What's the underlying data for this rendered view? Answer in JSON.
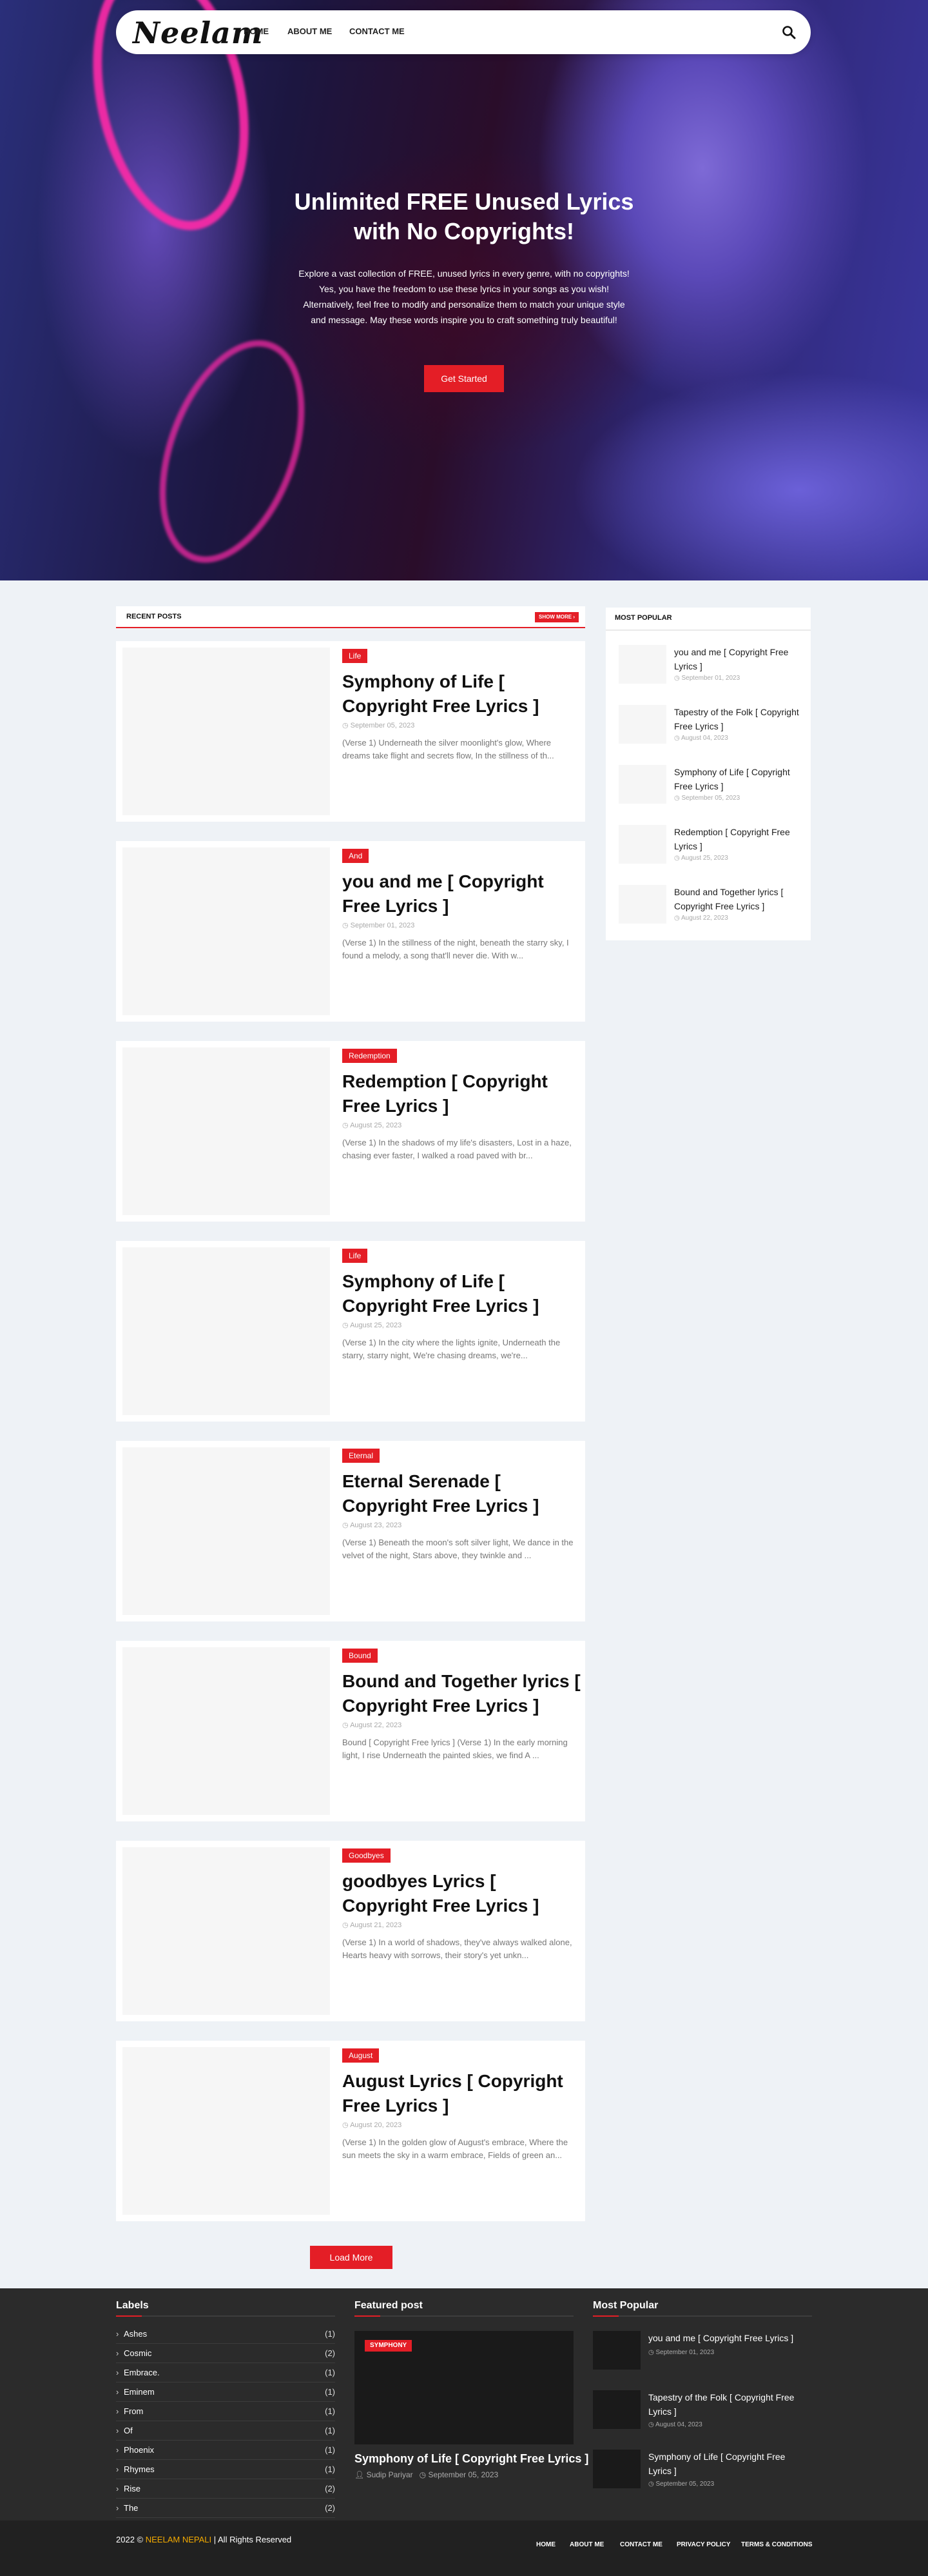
{
  "header": {
    "logo": "Neelam",
    "nav": [
      "HOME",
      "ABOUT ME",
      "CONTACT ME"
    ],
    "search_icon": "search-icon"
  },
  "hero": {
    "title": "Unlimited FREE Unused Lyrics with No Copyrights!",
    "description": "Explore a vast collection of FREE, unused lyrics in every genre, with no copyrights! Yes, you have the freedom to use these lyrics in your songs as you wish! Alternatively, feel free to modify and personalize them to match your unique style and message. May these words inspire you to craft something truly beautiful!",
    "button": "Get Started"
  },
  "recent": {
    "title": "RECENT POSTS",
    "show_more": "SHOW MORE",
    "posts": [
      {
        "tag": "Life",
        "title": "Symphony of Life [ Copyright Free Lyrics ]",
        "date": "September 05, 2023",
        "excerpt": "(Verse 1) Underneath the silver moonlight's glow, Where dreams take flight and secrets flow, In the stillness of th..."
      },
      {
        "tag": "And",
        "title": "you and me [ Copyright Free Lyrics ]",
        "date": "September 01, 2023",
        "excerpt": "(Verse 1) In the stillness of the night, beneath the starry sky, I found a melody, a song that'll never die. With w..."
      },
      {
        "tag": "Redemption",
        "title": "Redemption [ Copyright Free Lyrics ]",
        "date": "August 25, 2023",
        "excerpt": "(Verse 1) In the shadows of my life's disasters, Lost in a haze, chasing ever faster, I walked a road paved with br..."
      },
      {
        "tag": "Life",
        "title": "Symphony of Life [ Copyright Free Lyrics ]",
        "date": "August 25, 2023",
        "excerpt": "(Verse 1) In the city where the lights ignite, Underneath the starry, starry night, We're chasing dreams, we're..."
      },
      {
        "tag": "Eternal",
        "title": "Eternal Serenade [ Copyright Free Lyrics ]",
        "date": "August 23, 2023",
        "excerpt": "(Verse 1) Beneath the moon's soft silver light, We dance in the velvet of the night, Stars above, they twinkle and ..."
      },
      {
        "tag": "Bound",
        "title": "Bound and Together lyrics [ Copyright Free Lyrics ]",
        "date": "August 22, 2023",
        "excerpt": "Bound [ Copyright Free lyrics ]   (Verse 1) In the early morning light, I rise Underneath the painted skies, we find A ..."
      },
      {
        "tag": "Goodbyes",
        "title": "goodbyes Lyrics [ Copyright Free Lyrics ]",
        "date": "August 21, 2023",
        "excerpt": "(Verse 1) In a world of shadows, they've always walked alone, Hearts heavy with sorrows, their story's yet unkn..."
      },
      {
        "tag": "August",
        "title": "August Lyrics [ Copyright Free Lyrics ]",
        "date": "August 20, 2023",
        "excerpt": "(Verse 1) In the golden glow of August's embrace, Where the sun meets the sky in a warm embrace, Fields of green an..."
      }
    ],
    "load_more": "Load More"
  },
  "sidebar": {
    "title": "MOST POPULAR",
    "items": [
      {
        "title": "you and me [ Copyright Free Lyrics ]",
        "date": "September 01, 2023"
      },
      {
        "title": "Tapestry of the Folk [ Copyright Free Lyrics ]",
        "date": "August 04, 2023"
      },
      {
        "title": "Symphony of Life [ Copyright Free Lyrics ]",
        "date": "September 05, 2023"
      },
      {
        "title": "Redemption [ Copyright Free Lyrics ]",
        "date": "August 25, 2023"
      },
      {
        "title": "Bound and Together lyrics [ Copyright Free Lyrics ]",
        "date": "August 22, 2023"
      }
    ]
  },
  "footer": {
    "labels_title": "Labels",
    "labels": [
      {
        "name": "Ashes",
        "count": "(1)"
      },
      {
        "name": "Cosmic",
        "count": "(2)"
      },
      {
        "name": "Embrace.",
        "count": "(1)"
      },
      {
        "name": "Eminem",
        "count": "(1)"
      },
      {
        "name": "From",
        "count": "(1)"
      },
      {
        "name": "Of",
        "count": "(1)"
      },
      {
        "name": "Phoenix",
        "count": "(1)"
      },
      {
        "name": "Rhymes",
        "count": "(1)"
      },
      {
        "name": "Rise",
        "count": "(2)"
      },
      {
        "name": "The",
        "count": "(2)"
      }
    ],
    "featured_title": "Featured post",
    "featured": {
      "tag": "SYMPHONY",
      "title": "Symphony of Life [ Copyright Free Lyrics ]",
      "author": "Sudip Pariyar",
      "date": "September 05, 2023"
    },
    "popular_title": "Most Popular",
    "popular": [
      {
        "title": "you and me [ Copyright Free Lyrics ]",
        "date": "September 01, 2023"
      },
      {
        "title": "Tapestry of the Folk [ Copyright Free Lyrics ]",
        "date": "August 04, 2023"
      },
      {
        "title": "Symphony of Life [ Copyright Free Lyrics ]",
        "date": "September 05, 2023"
      }
    ],
    "copyright_prefix": "2022 ©",
    "brand": "NEELAM NEPALI",
    "copyright_suffix": "| All Rights Reserved",
    "links": [
      "HOME",
      "ABOUT ME",
      "CONTACT ME",
      "PRIVACY POLICY",
      "TERMS & CONDITIONS"
    ]
  },
  "colors": {
    "accent": "#e41e26",
    "brand_footer": "#f2a900",
    "footer_bg": "#2b2b2b"
  }
}
